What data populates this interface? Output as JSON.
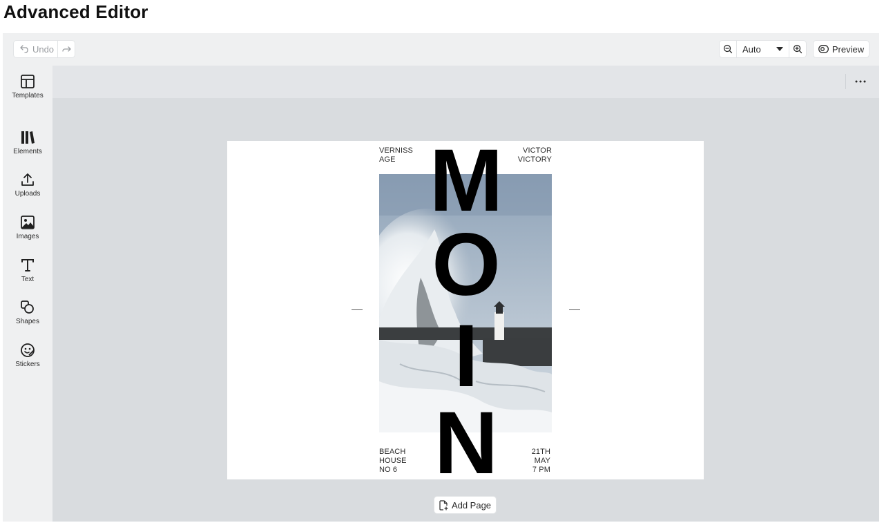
{
  "page": {
    "title": "Advanced Editor"
  },
  "toolbar": {
    "undo_label": "Undo",
    "zoom_value": "Auto",
    "preview_label": "Preview"
  },
  "sidebar": {
    "items": [
      {
        "label": "Templates",
        "icon": "layout-icon"
      },
      {
        "label": "Elements",
        "icon": "library-icon"
      },
      {
        "label": "Uploads",
        "icon": "upload-icon"
      },
      {
        "label": "Images",
        "icon": "image-icon"
      },
      {
        "label": "Text",
        "icon": "text-icon"
      },
      {
        "label": "Shapes",
        "icon": "shapes-icon"
      },
      {
        "label": "Stickers",
        "icon": "sticker-icon"
      }
    ]
  },
  "poster": {
    "top_left": [
      "VERNISS",
      "AGE"
    ],
    "top_right": [
      "VICTOR",
      "VICTORY"
    ],
    "bottom_left": [
      "BEACH",
      "HOUSE",
      "NO 6"
    ],
    "bottom_right": [
      "21TH",
      "MAY",
      "7 PM"
    ],
    "letters": [
      "M",
      "O",
      "I",
      "N"
    ]
  },
  "footer": {
    "add_page_label": "Add Page"
  },
  "colors": {
    "canvas_bg": "#d9dcdf",
    "toolbar_bg": "#eff0f1",
    "accent_text": "#2a2a2a"
  }
}
